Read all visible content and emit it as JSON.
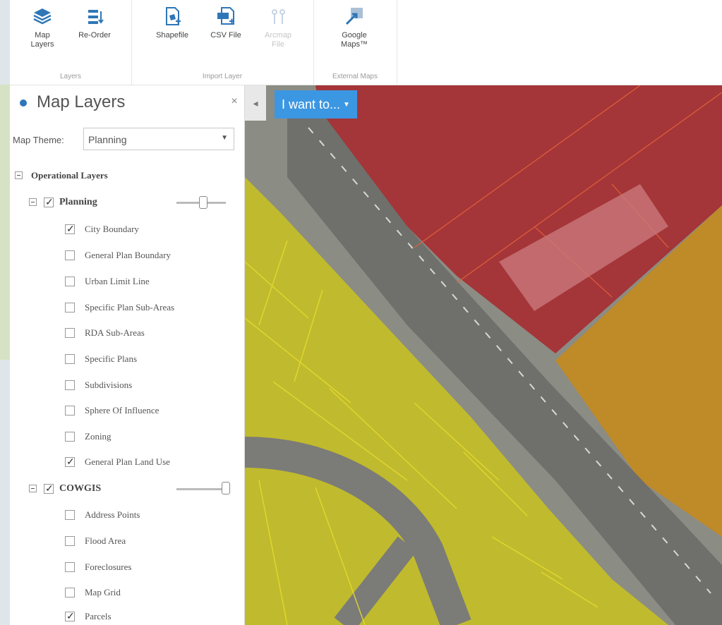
{
  "ribbon": {
    "groups": [
      {
        "label": "Layers",
        "buttons": [
          {
            "label": "Map\nLayers"
          },
          {
            "label": "Re-Order"
          }
        ]
      },
      {
        "label": "Import Layer",
        "buttons": [
          {
            "label": "Shapefile"
          },
          {
            "label": "CSV File"
          },
          {
            "label": "Arcmap\nFile"
          }
        ]
      },
      {
        "label": "External Maps",
        "buttons": [
          {
            "label": "Google\nMaps™"
          }
        ]
      }
    ]
  },
  "panel": {
    "title": "Map Layers",
    "close": "×",
    "theme_label": "Map Theme:",
    "theme_value": "Planning",
    "root": "Operational Layers",
    "groups": [
      {
        "name": "Planning",
        "checked": true,
        "layers": [
          {
            "name": "City Boundary",
            "checked": true
          },
          {
            "name": "General Plan Boundary",
            "checked": false
          },
          {
            "name": "Urban Limit Line",
            "checked": false
          },
          {
            "name": "Specific Plan Sub-Areas",
            "checked": false
          },
          {
            "name": "RDA Sub-Areas",
            "checked": false
          },
          {
            "name": "Specific Plans",
            "checked": false
          },
          {
            "name": "Subdivisions",
            "checked": false
          },
          {
            "name": "Sphere Of Influence",
            "checked": false
          },
          {
            "name": "Zoning",
            "checked": false
          },
          {
            "name": "General Plan Land Use",
            "checked": true
          }
        ]
      },
      {
        "name": "COWGIS",
        "checked": true,
        "layers": [
          {
            "name": "Address Points",
            "checked": false
          },
          {
            "name": "Flood Area",
            "checked": false
          },
          {
            "name": "Foreclosures",
            "checked": false
          },
          {
            "name": "Map Grid",
            "checked": false
          },
          {
            "name": "Parcels",
            "checked": true
          }
        ]
      }
    ]
  },
  "map": {
    "iwant_label": "I want to...",
    "collapse": "◂",
    "colors": {
      "red": "#b3262b",
      "orange": "#d69a17",
      "yellow": "#d8cf1e",
      "road": "#7c7c7a"
    }
  }
}
